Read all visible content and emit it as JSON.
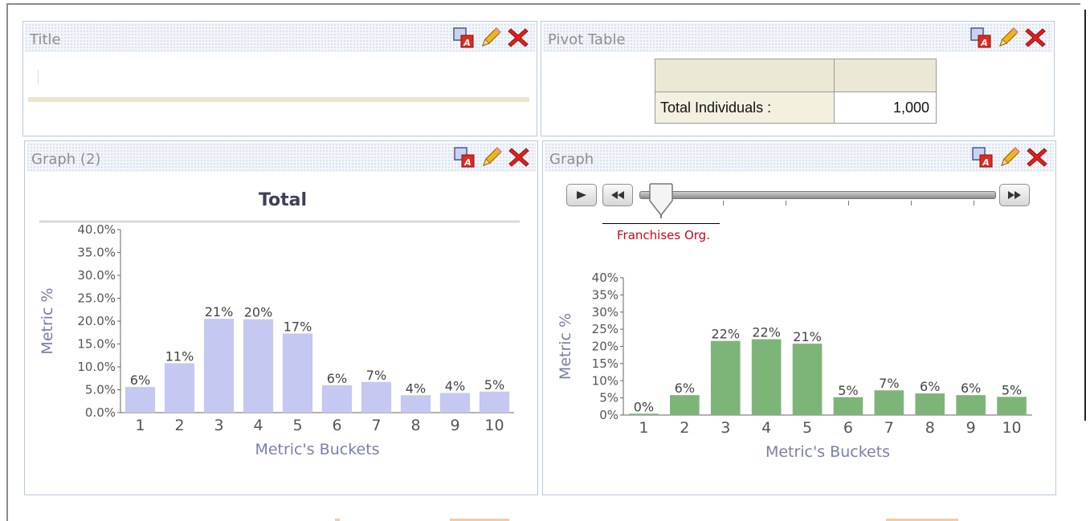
{
  "panels": {
    "title_panel": {
      "title": "Title"
    },
    "pivot_panel": {
      "title": "Pivot Table",
      "row_label": "Total Individuals :",
      "row_value": "1,000"
    },
    "graph2_panel": {
      "title": "Graph (2)"
    },
    "graph_panel": {
      "title": "Graph",
      "slider_label": "Franchises Org."
    }
  },
  "icons": {
    "format": "format-icon",
    "edit": "pencil-icon",
    "delete": "delete-x-icon",
    "play": "play-icon",
    "rewind": "rewind-icon",
    "fast_forward": "fast-forward-icon"
  },
  "colors": {
    "bar_left": "#c5c8f0",
    "bar_right": "#7db578",
    "axis_text": "#7a7fa6",
    "slider_label": "#d0021b",
    "delete_red": "#e0201b"
  },
  "chart_data": [
    {
      "type": "bar",
      "title": "Total",
      "xlabel": "Metric's Buckets",
      "ylabel": "Metric %",
      "categories": [
        "1",
        "2",
        "3",
        "4",
        "5",
        "6",
        "7",
        "8",
        "9",
        "10"
      ],
      "values": [
        5.6,
        10.8,
        20.5,
        20.4,
        17.3,
        6.0,
        6.7,
        3.8,
        4.3,
        4.6
      ],
      "value_labels": [
        "6%",
        "11%",
        "21%",
        "20%",
        "17%",
        "6%",
        "7%",
        "4%",
        "4%",
        "5%"
      ],
      "yticks": [
        "0.0%",
        "5.0%",
        "10.0%",
        "15.0%",
        "20.0%",
        "25.0%",
        "30.0%",
        "35.0%",
        "40.0%"
      ],
      "ylim": [
        0,
        40
      ]
    },
    {
      "type": "bar",
      "title": "",
      "xlabel": "Metric's Buckets",
      "ylabel": "Metric %",
      "categories": [
        "1",
        "2",
        "3",
        "4",
        "5",
        "6",
        "7",
        "8",
        "9",
        "10"
      ],
      "values": [
        0.4,
        5.8,
        21.6,
        22.1,
        20.8,
        5.2,
        7.2,
        6.3,
        5.8,
        5.3
      ],
      "value_labels": [
        "0%",
        "6%",
        "22%",
        "22%",
        "21%",
        "5%",
        "7%",
        "6%",
        "6%",
        "5%"
      ],
      "yticks": [
        "0%",
        "5%",
        "10%",
        "15%",
        "20%",
        "25%",
        "30%",
        "35%",
        "40%"
      ],
      "ylim": [
        0,
        40
      ]
    }
  ]
}
